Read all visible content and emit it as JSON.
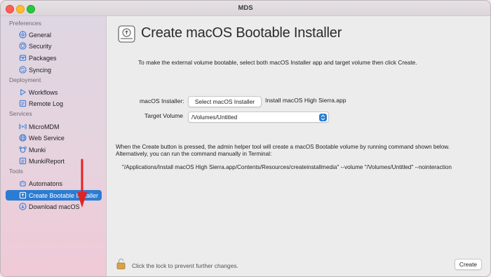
{
  "window": {
    "title": "MDS"
  },
  "sidebar": {
    "sections": [
      {
        "title": "Preferences",
        "items": [
          {
            "label": "General",
            "icon": "gear-icon"
          },
          {
            "label": "Security",
            "icon": "shield-icon"
          },
          {
            "label": "Packages",
            "icon": "package-icon"
          },
          {
            "label": "Syncing",
            "icon": "sync-icon"
          }
        ]
      },
      {
        "title": "Deployment",
        "items": [
          {
            "label": "Workflows",
            "icon": "play-icon"
          },
          {
            "label": "Remote Log",
            "icon": "document-icon"
          }
        ]
      },
      {
        "title": "Services",
        "items": [
          {
            "label": "MicroMDM",
            "icon": "antenna-icon"
          },
          {
            "label": "Web Service",
            "icon": "globe-icon"
          },
          {
            "label": "Munki",
            "icon": "munki-icon"
          },
          {
            "label": "MunkiReport",
            "icon": "report-icon"
          }
        ]
      },
      {
        "title": "Tools",
        "items": [
          {
            "label": "Automatons",
            "icon": "robot-icon"
          },
          {
            "label": "Create Bootable Installer",
            "icon": "installer-icon",
            "selected": true
          },
          {
            "label": "Download macOS",
            "icon": "download-icon"
          }
        ]
      }
    ]
  },
  "main": {
    "title": "Create macOS Bootable Installer",
    "intro": "To make the external volume bootable, select both macOS Installer app and target volume then click Create.",
    "installer_label": "macOS Installer:",
    "select_installer_button": "Select macOS Installer",
    "installer_value": "Install macOS High Sierra.app",
    "target_volume_label": "Target Volume",
    "target_volume_value": "/Volumes/Untitled",
    "note_line1": "When the Create button is pressed, the admin helper tool will create a macOS Bootable volume by running command shown below.",
    "note_line2": "Alternatively, you can run the command manually in Terminal:",
    "command": "\"/Applications/Install macOS High Sierra.app/Contents/Resources/createinstallmedia\" --volume \"/Volumes/Untitled\" --nointeraction",
    "lock_text": "Click the lock to prevent further changes.",
    "create_button": "Create"
  },
  "colors": {
    "accent": "#2b7cd3",
    "annotation_arrow": "#e32222",
    "icon_blue": "#2d74d6"
  }
}
